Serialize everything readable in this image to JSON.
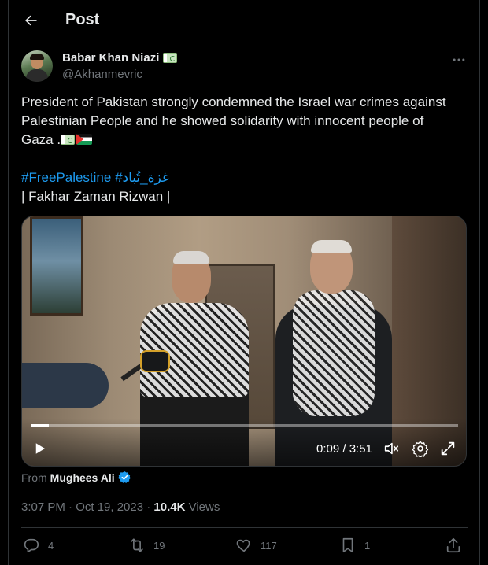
{
  "header": {
    "title": "Post"
  },
  "author": {
    "display_name": "Babar Khan Niazi",
    "handle": "@Akhanmevric"
  },
  "tweet": {
    "text_line1": "President of Pakistan  strongly condemned the Israel war crimes against",
    "text_line2": "Palestinian People and he showed solidarity with innocent people of",
    "text_line3": "Gaza .",
    "hashtags": "#FreePalestine #غزة_تُباد",
    "credit": "| Fakhar Zaman Rizwan |"
  },
  "video": {
    "time": "0:09 / 3:51",
    "progress": 0.04
  },
  "source": {
    "label": "From",
    "name": "Mughees Ali"
  },
  "meta": {
    "time_date": "3:07 PM · Oct 19, 2023 · ",
    "views_count": "10.4K",
    "views_label": " Views"
  },
  "actions": {
    "replies": "4",
    "reposts": "19",
    "likes": "117",
    "bookmarks": "1"
  },
  "colors": {
    "background": "#000000",
    "text": "#e7e9ea",
    "muted": "#71767b",
    "accent": "#1d9bf0",
    "border": "#2f3336"
  },
  "icons": [
    "back-arrow-icon",
    "more-icon",
    "play-icon",
    "volume-icon",
    "settings-icon",
    "fullscreen-icon",
    "verified-icon",
    "reply-icon",
    "repost-icon",
    "like-icon",
    "bookmark-icon",
    "share-icon"
  ]
}
